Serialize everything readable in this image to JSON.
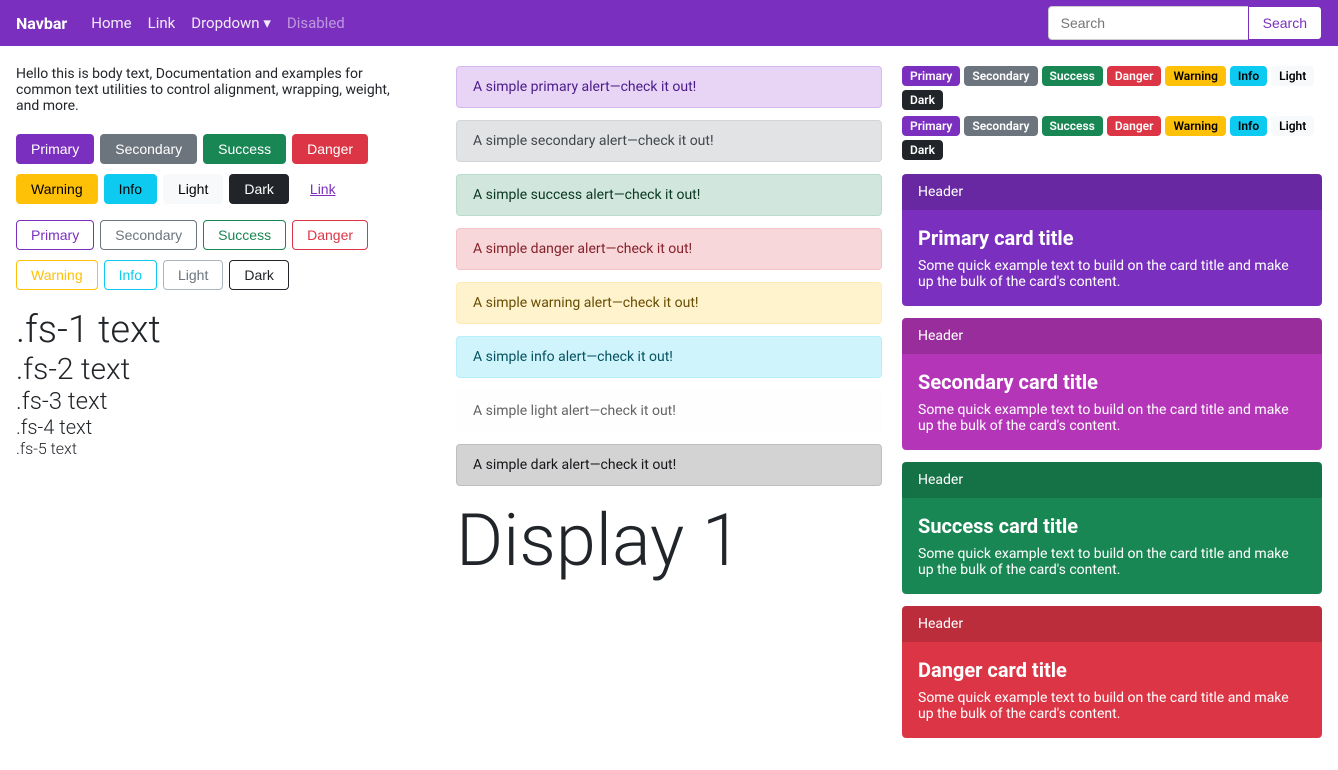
{
  "navbar": {
    "brand": "Navbar",
    "links": [
      {
        "label": "Home",
        "disabled": false
      },
      {
        "label": "Link",
        "disabled": false
      },
      {
        "label": "Dropdown",
        "disabled": false,
        "dropdown": true
      },
      {
        "label": "Disabled",
        "disabled": true
      }
    ],
    "search_placeholder": "Search",
    "search_button": "Search"
  },
  "body_text": "Hello this is body text, Documentation and examples for common text utilities to control alignment, wrapping, weight, and more.",
  "buttons_solid": {
    "primary": "Primary",
    "secondary": "Secondary",
    "success": "Success",
    "danger": "Danger",
    "warning": "Warning",
    "info": "Info",
    "light": "Light",
    "dark": "Dark",
    "link": "Link"
  },
  "buttons_outline": {
    "primary": "Primary",
    "secondary": "Secondary",
    "success": "Success",
    "danger": "Danger",
    "warning": "Warning",
    "info": "Info",
    "light": "Light",
    "dark": "Dark"
  },
  "font_sizes": [
    ".fs-1 text",
    ".fs-2 text",
    ".fs-3 text",
    ".fs-4 text",
    ".fs-5 text"
  ],
  "alerts": [
    {
      "type": "primary",
      "text": "A simple primary alert—check it out!"
    },
    {
      "type": "secondary",
      "text": "A simple secondary alert—check it out!"
    },
    {
      "type": "success",
      "text": "A simple success alert—check it out!"
    },
    {
      "type": "danger",
      "text": "A simple danger alert—check it out!"
    },
    {
      "type": "warning",
      "text": "A simple warning alert—check it out!"
    },
    {
      "type": "info",
      "text": "A simple info alert—check it out!"
    },
    {
      "type": "light",
      "text": "A simple light alert—check it out!"
    },
    {
      "type": "dark",
      "text": "A simple dark alert—check it out!"
    }
  ],
  "display_text": "Display 1",
  "badges_row1": [
    {
      "type": "primary",
      "label": "Primary"
    },
    {
      "type": "secondary",
      "label": "Secondary"
    },
    {
      "type": "success",
      "label": "Success"
    },
    {
      "type": "danger",
      "label": "Danger"
    },
    {
      "type": "warning",
      "label": "Warning"
    },
    {
      "type": "info",
      "label": "Info"
    },
    {
      "type": "light",
      "label": "Light"
    },
    {
      "type": "dark",
      "label": "Dark"
    }
  ],
  "badges_row2": [
    {
      "type": "primary",
      "label": "Primary"
    },
    {
      "type": "secondary",
      "label": "Secondary"
    },
    {
      "type": "success",
      "label": "Success"
    },
    {
      "type": "danger",
      "label": "Danger"
    },
    {
      "type": "warning",
      "label": "Warning"
    },
    {
      "type": "info",
      "label": "Info"
    },
    {
      "type": "light",
      "label": "Light"
    },
    {
      "type": "dark",
      "label": "Dark"
    }
  ],
  "cards": [
    {
      "type": "primary",
      "header": "Header",
      "title": "Primary card title",
      "text": "Some quick example text to build on the card title and make up the bulk of the card's content."
    },
    {
      "type": "secondary",
      "header": "Header",
      "title": "Secondary card title",
      "text": "Some quick example text to build on the card title and make up the bulk of the card's content."
    },
    {
      "type": "success",
      "header": "Header",
      "title": "Success card title",
      "text": "Some quick example text to build on the card title and make up the bulk of the card's content."
    },
    {
      "type": "danger",
      "header": "Header",
      "title": "Danger card title",
      "text": "Some quick example text to build on the card title and make up the bulk of the card's content."
    }
  ]
}
